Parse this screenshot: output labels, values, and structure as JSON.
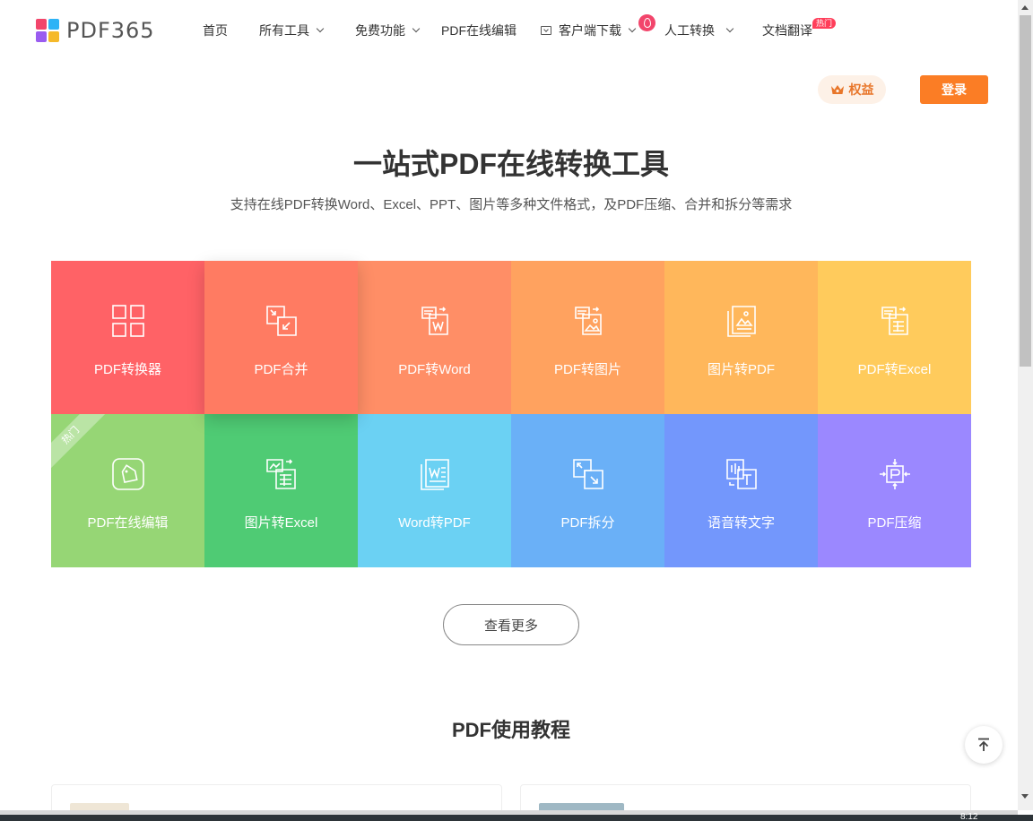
{
  "header": {
    "logo_text": "PDF365",
    "logo_colors": [
      "#f2456b",
      "#2db3f6",
      "#9a5cf0",
      "#f5b92a"
    ],
    "nav": [
      {
        "label": "首页",
        "dropdown": false
      },
      {
        "label": "所有工具",
        "dropdown": true
      },
      {
        "label": "免费功能",
        "dropdown": true
      },
      {
        "label": "PDF在线编辑",
        "dropdown": false
      },
      {
        "label": "客户端下载",
        "dropdown": true
      },
      {
        "label": "人工转换",
        "dropdown": true
      },
      {
        "label": "文档翻译",
        "dropdown": false
      }
    ],
    "hot_badge": "热门",
    "rights_label": "权益",
    "login_label": "登录"
  },
  "hero": {
    "title": "一站式PDF在线转换工具",
    "subtitle": "支持在线PDF转换Word、Excel、PPT、图片等多种文件格式，及PDF压缩、合并和拆分等需求"
  },
  "tools": [
    {
      "label": "PDF转换器",
      "icon": "grid-icon",
      "color": "#ff6266"
    },
    {
      "label": "PDF合并",
      "icon": "merge-icon",
      "color": "#ff7b62"
    },
    {
      "label": "PDF转Word",
      "icon": "pdf-to-word-icon",
      "color": "#ff8e66"
    },
    {
      "label": "PDF转图片",
      "icon": "pdf-to-image-icon",
      "color": "#ffa25f"
    },
    {
      "label": "图片转PDF",
      "icon": "image-to-pdf-icon",
      "color": "#ffb75b"
    },
    {
      "label": "PDF转Excel",
      "icon": "pdf-to-excel-icon",
      "color": "#ffcb5c"
    },
    {
      "label": "PDF在线编辑",
      "icon": "edit-icon",
      "color": "#96d675",
      "ribbon": "热门"
    },
    {
      "label": "图片转Excel",
      "icon": "image-to-excel-icon",
      "color": "#4fcb74"
    },
    {
      "label": "Word转PDF",
      "icon": "word-to-pdf-icon",
      "color": "#6bd1f3"
    },
    {
      "label": "PDF拆分",
      "icon": "split-icon",
      "color": "#6ab0f7"
    },
    {
      "label": "语音转文字",
      "icon": "speech-to-text-icon",
      "color": "#7397fc"
    },
    {
      "label": "PDF压缩",
      "icon": "compress-icon",
      "color": "#9b88ff"
    }
  ],
  "more_label": "查看更多",
  "tutorial_title": "PDF使用教程",
  "clock": "8:12",
  "accent": "#fb7d25"
}
